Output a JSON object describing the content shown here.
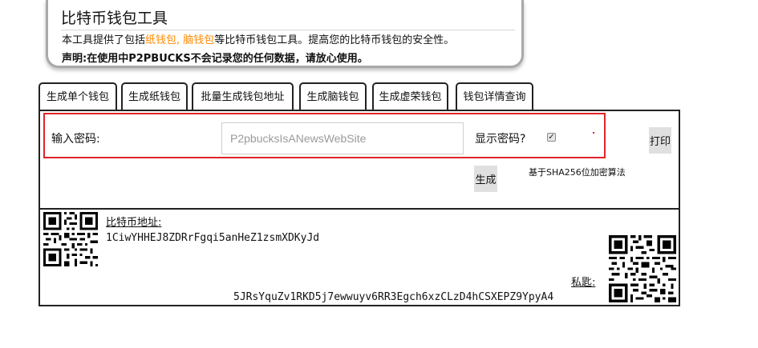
{
  "info": {
    "title": "比特币钱包工具",
    "desc_prefix": "本工具提供了包括",
    "desc_highlight": "纸钱包, 脑钱包",
    "desc_suffix": "等比特币钱包工具。提高您的比特币钱包的安全性。",
    "note": "声明:在使用中P2PBUCKS不会记录您的任何数据，请放心使用。",
    "highlight_color": "#ff8a00"
  },
  "tabs": [
    {
      "label": "生成单个钱包",
      "active": false
    },
    {
      "label": "生成纸钱包",
      "active": false
    },
    {
      "label": "批量生成钱包地址",
      "active": false
    },
    {
      "label": "生成脑钱包",
      "active": true
    },
    {
      "label": "生成虚荣钱包",
      "active": false
    },
    {
      "label": "钱包详情查询",
      "active": false
    }
  ],
  "brain": {
    "password_label": "输入密码:",
    "password_placeholder": "P2pbucksIsANewsWebSite",
    "show_password_label": "显示密码?",
    "show_password_checked": true,
    "print_label": "打印",
    "generate_label": "生成",
    "algorithm_note": "基于SHA256位加密算法"
  },
  "wallet": {
    "address_label": "比特币地址:",
    "address": "1CiwYHHEJ8ZDRrFgqi5anHeZ1zsmXDKyJd",
    "private_key_label": "私匙:",
    "private_key": "5JRsYquZv1RKD5j7ewwuyv6RR3Egch6xzCLzD4hCSXEPZ9YpyA4",
    "qr_icon_left": "qr-code-icon",
    "qr_icon_right": "qr-code-icon"
  },
  "colors": {
    "border_red": "#e0242a",
    "button_gray": "#e0e0e0"
  }
}
